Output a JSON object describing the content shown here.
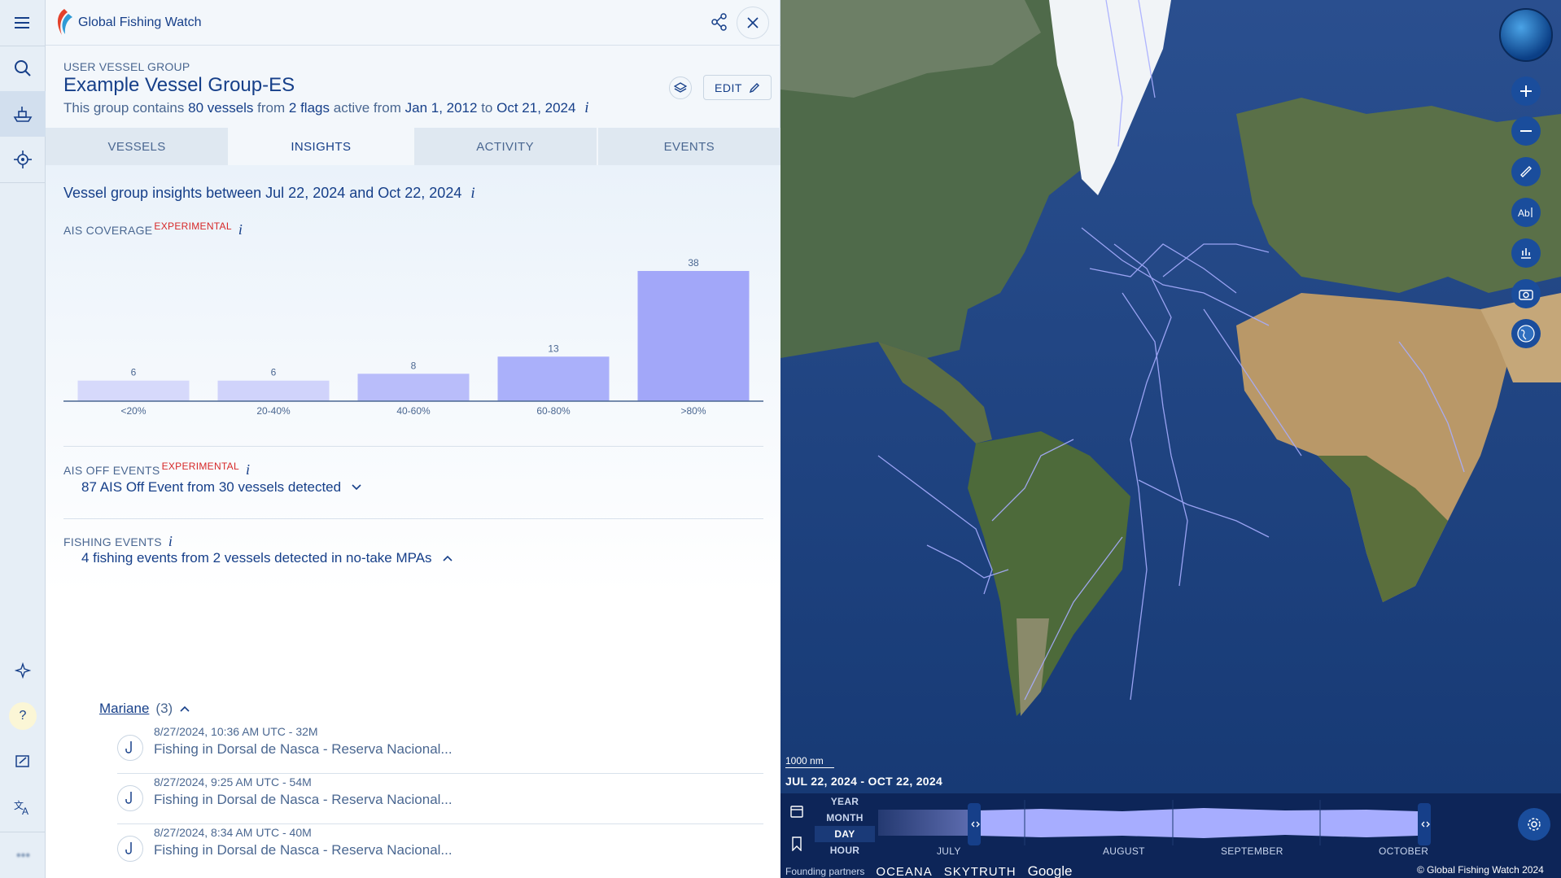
{
  "app": {
    "title": "Global Fishing Watch"
  },
  "group": {
    "type_label": "USER VESSEL GROUP",
    "title": "Example Vessel Group-ES",
    "desc_prefix": "This group contains",
    "vessels": "80 vessels",
    "from_text": "from",
    "flags": "2 flags",
    "active_text": "active from",
    "start": "Jan 1, 2012",
    "to_text": "to",
    "end": "Oct 21, 2024",
    "info": "i"
  },
  "edit_label": "EDIT",
  "tabs": [
    {
      "label": "VESSELS"
    },
    {
      "label": "INSIGHTS"
    },
    {
      "label": "ACTIVITY"
    },
    {
      "label": "EVENTS"
    }
  ],
  "insights": {
    "title": "Vessel group insights between Jul 22, 2024 and Oct 22, 2024",
    "info": "i",
    "ais_coverage": {
      "label": "AIS COVERAGE",
      "badge": "EXPERIMENTAL"
    },
    "ais_off": {
      "label": "AIS OFF EVENTS",
      "badge": "EXPERIMENTAL",
      "summary": "87 AIS Off Event from 30 vessels detected"
    },
    "fishing": {
      "label": "FISHING EVENTS",
      "summary": "4 fishing events from 2 vessels detected in no-take MPAs",
      "vessel_name": "Mariane",
      "vessel_count": "(3)",
      "events": [
        {
          "time": "8/27/2024, 10:36 AM UTC - 32M",
          "name": "Fishing in Dorsal de Nasca - Reserva Nacional..."
        },
        {
          "time": "8/27/2024, 9:25 AM UTC - 54M",
          "name": "Fishing in Dorsal de Nasca - Reserva Nacional..."
        },
        {
          "time": "8/27/2024, 8:34 AM UTC - 40M",
          "name": "Fishing in Dorsal de Nasca - Reserva Nacional..."
        }
      ]
    }
  },
  "chart_data": {
    "type": "bar",
    "categories": [
      "<20%",
      "20-40%",
      "40-60%",
      "60-80%",
      ">80%"
    ],
    "values": [
      6,
      6,
      8,
      13,
      38
    ],
    "ylim": [
      0,
      38
    ],
    "grid": false,
    "colors": [
      "#d6d9fb",
      "#d0d3fb",
      "#b9bdfa",
      "#aab0fa",
      "#a2a7f9"
    ]
  },
  "map": {
    "scale": "1000 nm",
    "date_range": "JUL 22, 2024 - OCT 22, 2024",
    "time_scales": [
      "YEAR",
      "MONTH",
      "DAY",
      "HOUR"
    ],
    "active_scale": "DAY",
    "months": [
      "JULY",
      "AUGUST",
      "SEPTEMBER",
      "OCTOBER"
    ],
    "partners_label": "Founding partners",
    "partners": [
      "OCEANA",
      "SKYTRUTH",
      "Google"
    ],
    "copyright": "© Global Fishing Watch 2024"
  },
  "colors": {
    "accent": "#163f89",
    "experimental": "#d62828",
    "bar": "#a2a7f9",
    "track": "#a7adff"
  }
}
